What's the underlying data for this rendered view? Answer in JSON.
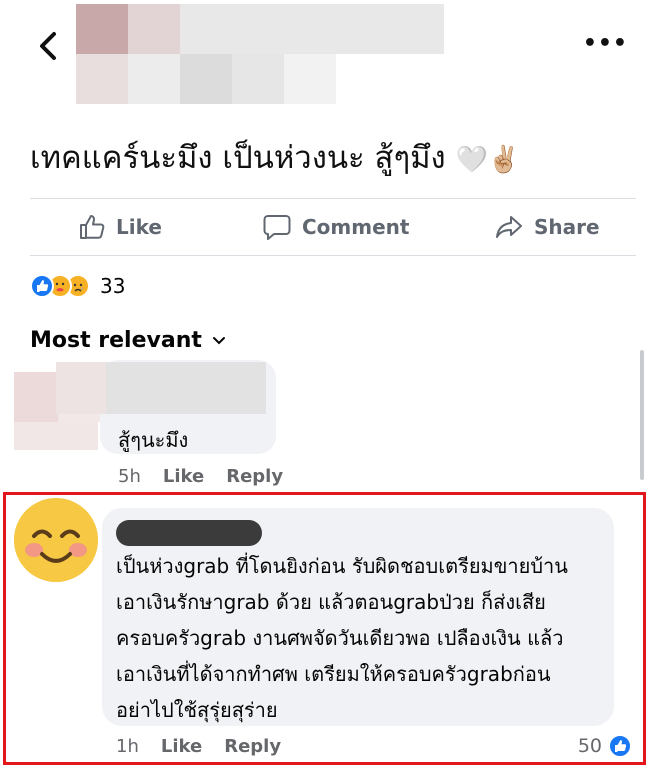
{
  "post": {
    "text": "เทคแคร์นะมึง เป็นห่วงนะ สู้ๆมึง",
    "emoji": "🤍✌🏼"
  },
  "actions": {
    "like": "Like",
    "comment": "Comment",
    "share": "Share"
  },
  "reactions": {
    "count": "33"
  },
  "sort": {
    "label": "Most relevant"
  },
  "comments": [
    {
      "text": "สู้ๆนะมึง",
      "time": "5h",
      "like": "Like",
      "reply": "Reply"
    },
    {
      "lines": [
        "เป็นห่วงgrab ที่โดนยิงก่อน รับผิดชอบเตรียมขายบ้าน",
        "เอาเงินรักษาgrab ด้วย แล้วตอนgrabป่วย ก็ส่งเสีย",
        "ครอบครัวgrab งานศพจัดวันเดียวพอ เปลืองเงิน แล้ว",
        "เอาเงินที่ได้จากทำศพ เตรียมให้ครอบครัวgrabก่อน",
        "อย่าไปใช้สุรุ่ยสุร่าย"
      ],
      "time": "1h",
      "like": "Like",
      "reply": "Reply",
      "reaction_count": "50"
    }
  ],
  "colors": {
    "highlight": "#e3161e",
    "like_blue": "#1877f2",
    "bubble": "#f0f2f5",
    "meta_gray": "#65676b"
  },
  "icons": [
    "back-arrow-icon",
    "more-icon",
    "like-icon",
    "comment-icon",
    "share-icon",
    "chevron-down-icon"
  ]
}
